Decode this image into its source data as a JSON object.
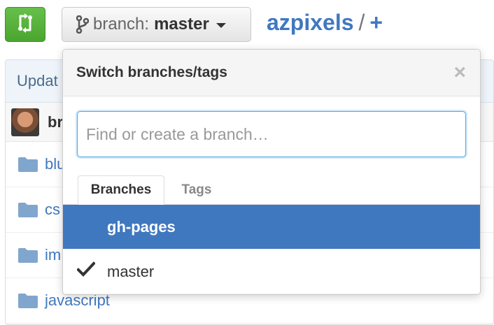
{
  "toolbar": {
    "branch_prefix": "branch:",
    "branch_name": "master"
  },
  "breadcrumb": {
    "repo": "azpixels",
    "separator": "/",
    "add": "+"
  },
  "file_table": {
    "commit_message": "Updat",
    "author": "br",
    "files": [
      {
        "name": "blu"
      },
      {
        "name": "cs"
      },
      {
        "name": "im"
      },
      {
        "name": "javascript"
      }
    ]
  },
  "dropdown": {
    "title": "Switch branches/tags",
    "close": "×",
    "search_placeholder": "Find or create a branch…",
    "tabs": [
      "Branches",
      "Tags"
    ],
    "branches": [
      {
        "name": "gh-pages",
        "selected": true,
        "checked": false
      },
      {
        "name": "master",
        "selected": false,
        "checked": true
      }
    ]
  },
  "colors": {
    "accent": "#4078c0",
    "compare_button": "#55b83a",
    "focus_border": "#51a7e8"
  }
}
